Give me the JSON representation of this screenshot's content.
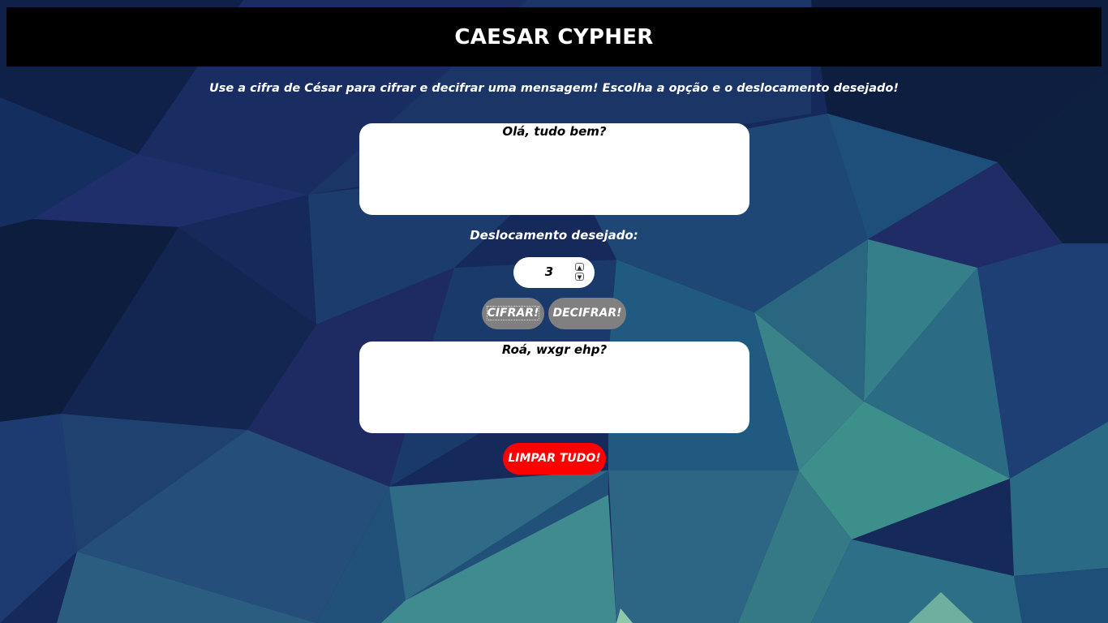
{
  "header": {
    "title": "CAESAR CYPHER"
  },
  "intro": "Use a cifra de César para cifrar e decifrar uma mensagem! Escolha a opção e o deslocamento desejado!",
  "input_box": {
    "value": "Olá, tudo bem?"
  },
  "shift": {
    "label": "Deslocamento desejado:",
    "value": "3"
  },
  "buttons": {
    "encrypt": "CIFRAR!",
    "decrypt": "DECIFRAR!",
    "clear": "LIMPAR TUDO!"
  },
  "output_box": {
    "value": "Roá, wxgr ehp?"
  },
  "colors": {
    "header_bg": "#000000",
    "button_gray": "#808080",
    "clear_red": "#ff0000",
    "background_dark": "#142a52",
    "background_teal": "#3f8a8d"
  },
  "icons": {
    "spin_up": "chevron-up-icon",
    "spin_down": "chevron-down-icon"
  }
}
